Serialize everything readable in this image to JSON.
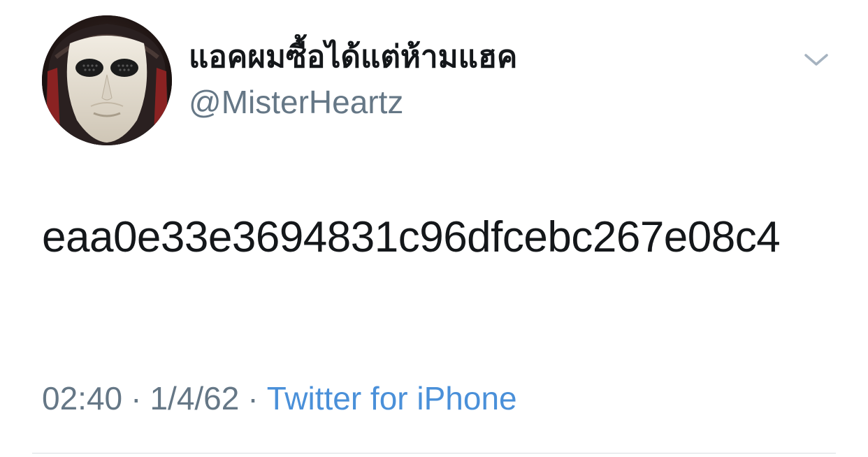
{
  "tweet": {
    "author": {
      "display_name": "แอคผมซื้อได้แต่ห้ามแฮค",
      "handle": "@MisterHeartz",
      "avatar_icon": "masked-face-avatar"
    },
    "menu_icon": "chevron-down-icon",
    "text": "eaa0e33e3694831c96dfcebc267e08c4",
    "time": "02:40",
    "date": "1/4/62",
    "separator": "·",
    "source": "Twitter for iPhone"
  },
  "colors": {
    "name": "#14171a",
    "secondary": "#657786",
    "link": "#4a90d9",
    "chevron": "#a6b3c0",
    "divider": "#d8dde2"
  }
}
